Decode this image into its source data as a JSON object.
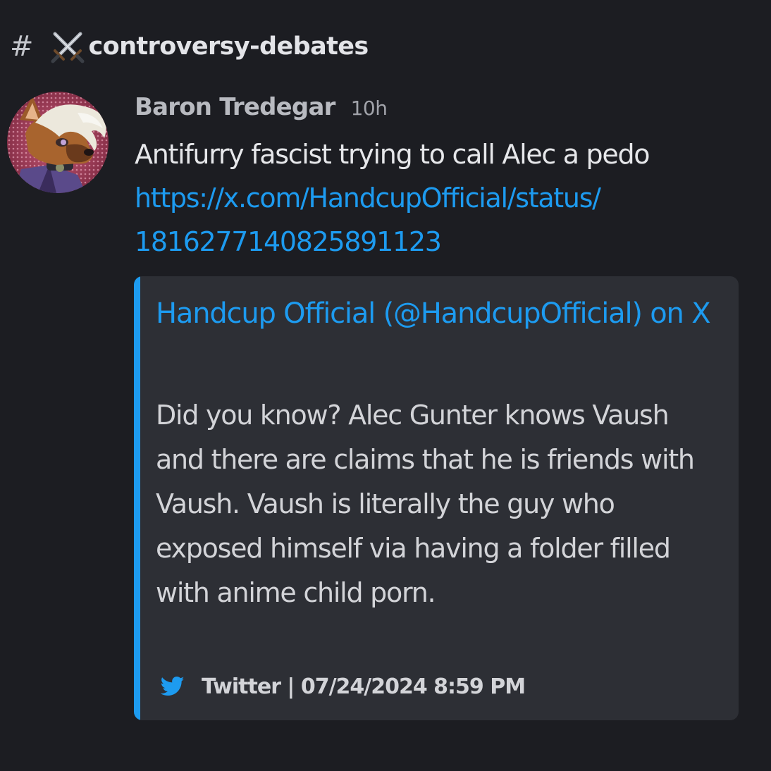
{
  "channel": {
    "hash": "#",
    "icon": "crossed-swords-icon",
    "name": "controversy-debates"
  },
  "message": {
    "author": "Baron Tredegar",
    "timestamp": "10h",
    "avatar_icon": "furry-character-avatar",
    "text": "Antifurry fascist trying to call Alec a pedo",
    "link_line1": "https://x.com/HandcupOfficial/status/",
    "link_line2": "1816277140825891123"
  },
  "embed": {
    "accent_color": "#1d9bf0",
    "title": "Handcup Official (@HandcupOfficial) on X",
    "description": "Did you know? Alec Gunter knows Vaush and there are claims that he is friends with Vaush. Vaush is literally the guy who exposed himself via having a folder filled with anime child porn.",
    "footer_icon": "twitter-bird-icon",
    "footer": "Twitter | 07/24/2024 8:59 PM"
  },
  "colors": {
    "background": "#1c1d22",
    "embed_background": "#2d2f35",
    "link": "#1d9bf0"
  }
}
